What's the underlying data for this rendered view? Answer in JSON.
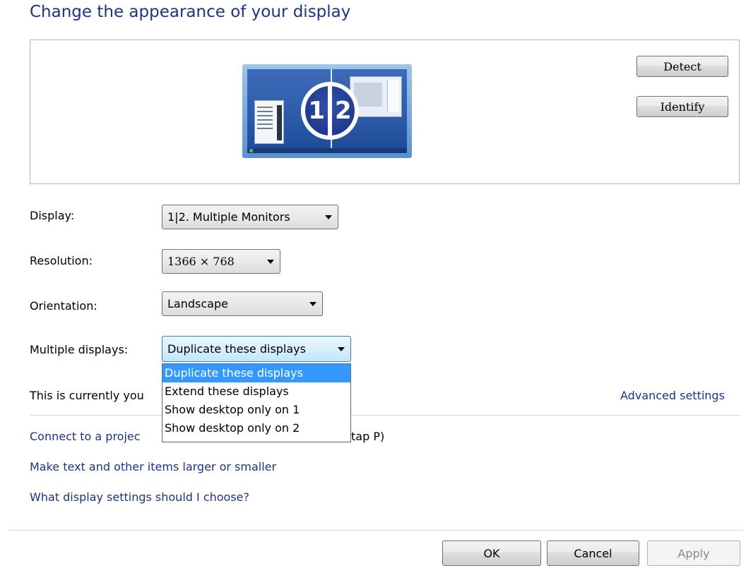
{
  "heading": "Change the appearance of your display",
  "preview": {
    "badge_left": "1",
    "badge_right": "2",
    "detect_button": "Detect",
    "identify_button": "Identify"
  },
  "form": {
    "display_label": "Display:",
    "display_value": "1|2. Multiple Monitors",
    "resolution_label": "Resolution:",
    "resolution_value": "1366 × 768",
    "orientation_label": "Orientation:",
    "orientation_value": "Landscape",
    "multiple_label": "Multiple displays:",
    "multiple_value": "Duplicate these displays",
    "multiple_options": [
      "Duplicate these displays",
      "Extend these displays",
      "Show desktop only on 1",
      "Show desktop only on 2"
    ]
  },
  "status": {
    "current_text": "This is currently you",
    "advanced_link": "Advanced settings"
  },
  "links": {
    "projector_prefix": "Connect to a projec",
    "projector_suffix": "tap P)",
    "text_size": "Make text and other items larger or smaller",
    "which_settings": "What display settings should I choose?"
  },
  "footer": {
    "ok": "OK",
    "cancel": "Cancel",
    "apply": "Apply"
  },
  "colors": {
    "heading": "#1e3287",
    "link": "#1e3287",
    "selected_option": "#3399ff"
  }
}
